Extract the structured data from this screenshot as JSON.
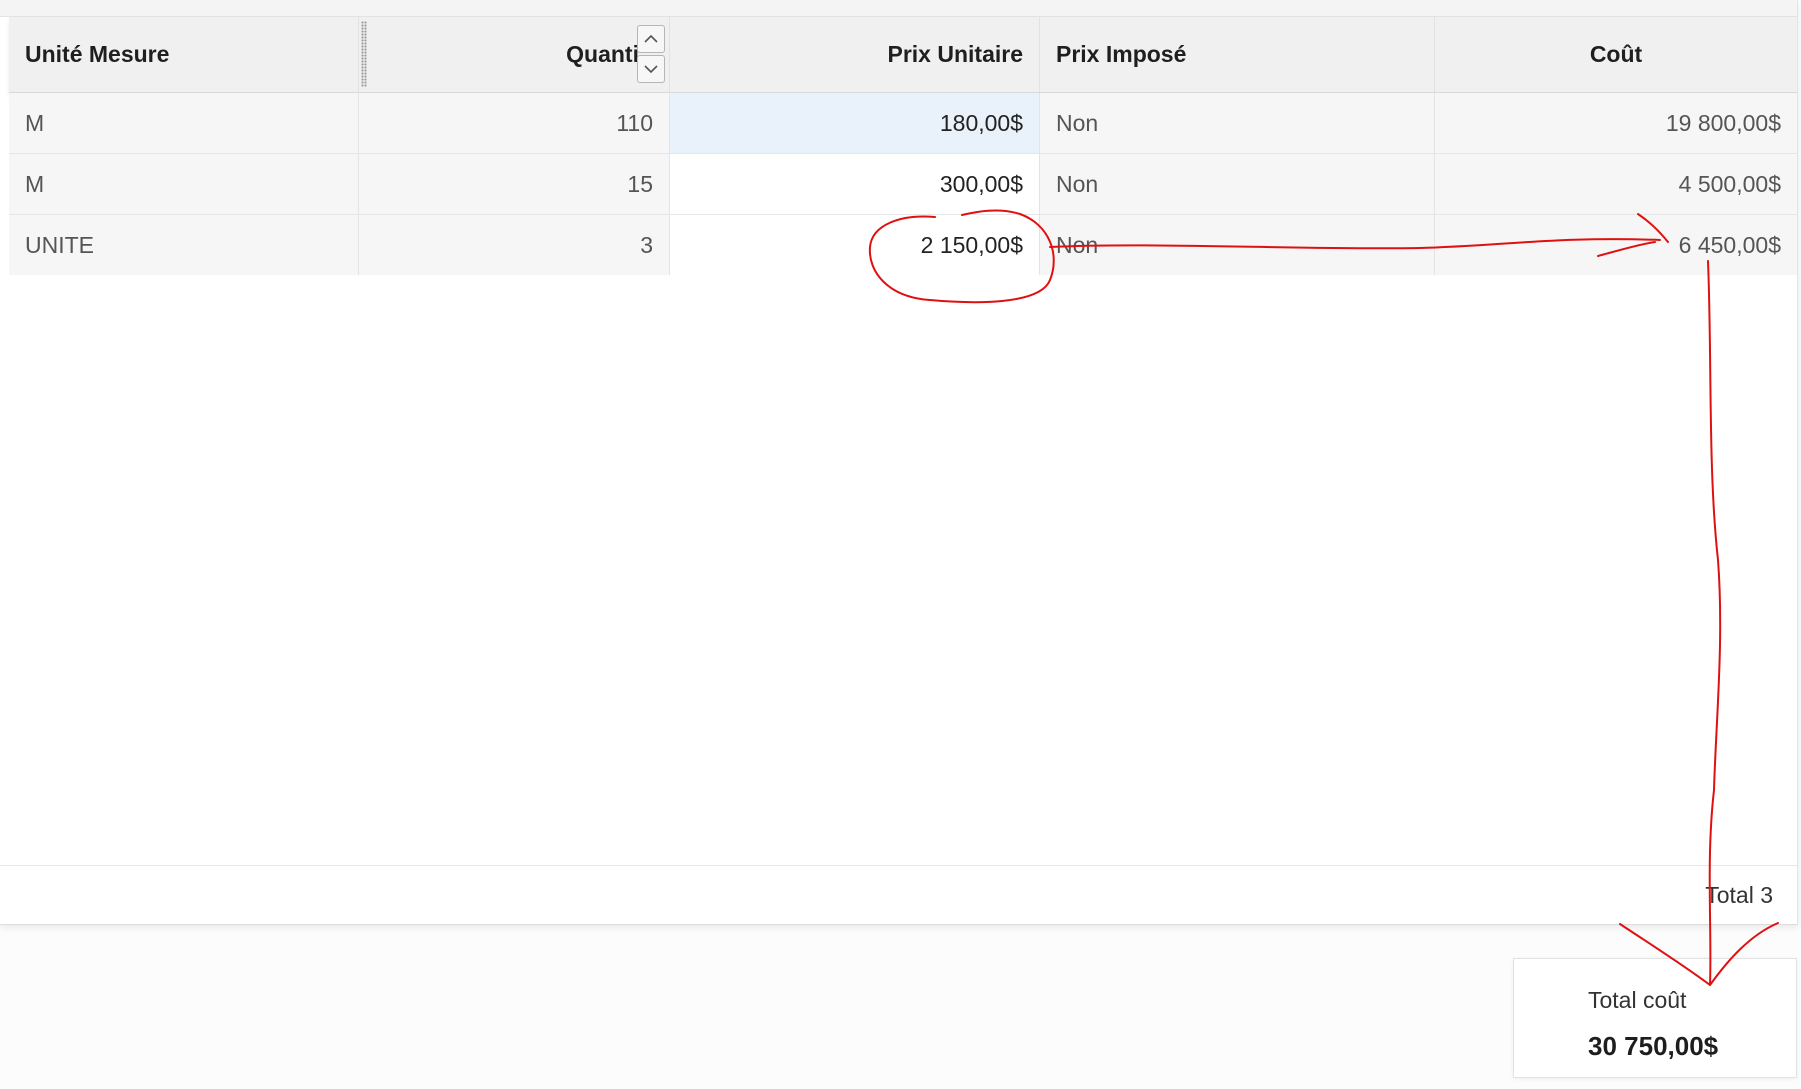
{
  "table": {
    "columns": [
      {
        "key": "unit",
        "label": "Unité Mesure"
      },
      {
        "key": "quantity",
        "label": "Quanti"
      },
      {
        "key": "unit_price",
        "label": "Prix Unitaire"
      },
      {
        "key": "imposed_price",
        "label": "Prix Imposé"
      },
      {
        "key": "cost",
        "label": "Coût"
      }
    ],
    "rows": [
      {
        "unit": "M",
        "quantity": "110",
        "unit_price": "180,00$",
        "imposed_price": "Non",
        "cost": "19 800,00$"
      },
      {
        "unit": "M",
        "quantity": "15",
        "unit_price": "300,00$",
        "imposed_price": "Non",
        "cost": "4 500,00$"
      },
      {
        "unit": "UNITE",
        "quantity": "3",
        "unit_price": "2 150,00$",
        "imposed_price": "Non",
        "cost": "6 450,00$"
      }
    ],
    "footer_total": "Total 3"
  },
  "summary": {
    "label": "Total coût",
    "value": "30 750,00$"
  },
  "colors": {
    "annotation": "#e01010",
    "selected_cell": "#e9f1fa"
  },
  "icons": {
    "sort_up": "chevron-up-icon",
    "sort_down": "chevron-down-icon"
  }
}
